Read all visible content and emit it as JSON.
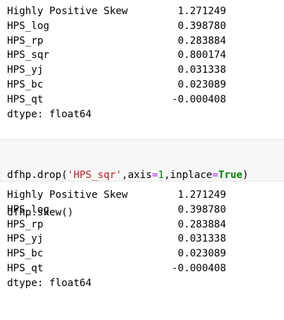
{
  "output1": {
    "rows": [
      {
        "name": "Highly Positive Skew",
        "value": "1.271249"
      },
      {
        "name": "HPS_log",
        "value": "0.398780"
      },
      {
        "name": "HPS_rp",
        "value": "0.283884"
      },
      {
        "name": "HPS_sqr",
        "value": "0.800174"
      },
      {
        "name": "HPS_yj",
        "value": "0.031338"
      },
      {
        "name": "HPS_bc",
        "value": "0.023089"
      },
      {
        "name": "HPS_qt",
        "value": "-0.000408"
      }
    ],
    "dtype": "dtype: float64"
  },
  "input": {
    "line1": {
      "obj": "dfhp.drop(",
      "arg_str": "'HPS_sqr'",
      "comma1": ",axis",
      "eq1": "=",
      "num1": "1",
      "comma2": ",inplace",
      "eq2": "=",
      "kw": "True",
      "close": ")"
    },
    "line2": "dfhp.skew()"
  },
  "output2": {
    "rows": [
      {
        "name": "Highly Positive Skew",
        "value": "1.271249"
      },
      {
        "name": "HPS_log",
        "value": "0.398780"
      },
      {
        "name": "HPS_rp",
        "value": "0.283884"
      },
      {
        "name": "HPS_yj",
        "value": "0.031338"
      },
      {
        "name": "HPS_bc",
        "value": "0.023089"
      },
      {
        "name": "HPS_qt",
        "value": "-0.000408"
      }
    ],
    "dtype": "dtype: float64"
  },
  "colors": {
    "string": "#ba2121",
    "operator": "#aa22ff",
    "number": "#008000",
    "keyword": "#008000",
    "input_background": "#f7f7f7"
  }
}
